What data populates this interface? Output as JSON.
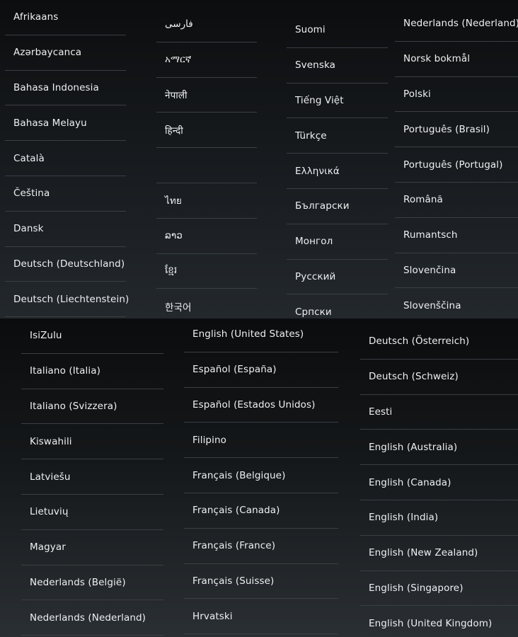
{
  "top_panel": {
    "columns": [
      [
        "Afrikaans",
        "Azərbaycanca",
        "Bahasa Indonesia",
        "Bahasa Melayu",
        "Català",
        "Čeština",
        "Dansk",
        "Deutsch (Deutschland)",
        "Deutsch (Liechtenstein)"
      ],
      [
        "فارسی",
        "አማርኛ",
        "नेपाली",
        "हिन्दी",
        "",
        "ไทย",
        "ລາວ",
        "ខ្មែរ",
        "한국어"
      ],
      [
        "Suomi",
        "Svenska",
        "Tiếng Việt",
        "Türkçe",
        "Ελληνικά",
        "Български",
        "Монгол",
        "Русский",
        "Српски"
      ],
      [
        "Nederlands (Nederland)",
        "Norsk bokmål",
        "Polski",
        "Português (Brasil)",
        "Português (Portugal)",
        "Română",
        "Rumantsch",
        "Slovenčina",
        "Slovenščina"
      ]
    ]
  },
  "bottom_panel": {
    "columns": [
      [
        "IsiZulu",
        "Italiano (Italia)",
        "Italiano (Svizzera)",
        "Kiswahili",
        "Latviešu",
        "Lietuvių",
        "Magyar",
        "Nederlands (België)",
        "Nederlands (Nederland)"
      ],
      [
        "English (United States)",
        "Español (España)",
        "Español (Estados Unidos)",
        "Filipino",
        "Français (Belgique)",
        "Français (Canada)",
        "Français (France)",
        "Français (Suisse)",
        "Hrvatski"
      ],
      [
        "Deutsch (Österreich)",
        "Deutsch (Schweiz)",
        "Eesti",
        "English (Australia)",
        "English (Canada)",
        "English (India)",
        "English (New Zealand)",
        "English (Singapore)",
        "English (United Kingdom)"
      ]
    ]
  }
}
